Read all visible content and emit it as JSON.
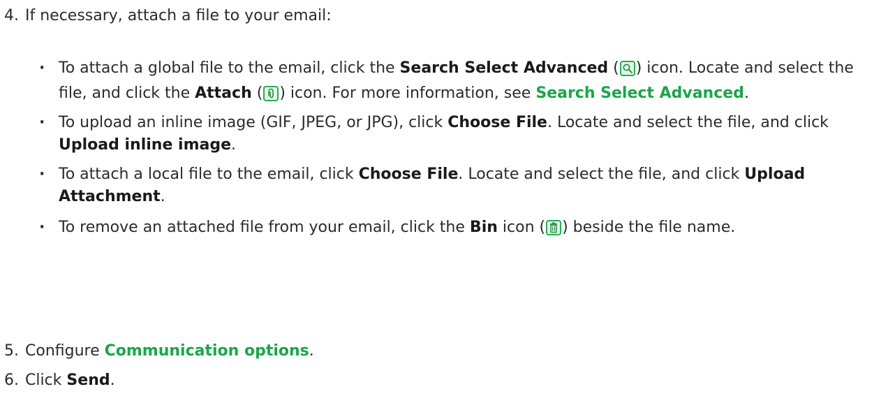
{
  "step4": {
    "number": "4.",
    "text": "If necessary, attach a file to your email:"
  },
  "bullets": [
    {
      "part1": "To attach a global file to the email, click the ",
      "bold1": "Search Select Advanced",
      "part2": " (",
      "icon1": "search-icon",
      "part3": ") icon. Locate and select the file, and click the ",
      "bold2": "Attach",
      "part4": " (",
      "icon2": "paperclip-icon",
      "part5": ") icon. For more information, see ",
      "link": "Search Select Advanced",
      "part6": "."
    },
    {
      "part1": "To upload an inline image (GIF, JPEG, or JPG), click ",
      "bold1": "Choose File",
      "part2": ". Locate and select the file, and click ",
      "bold2": "Upload inline image",
      "part3": "."
    },
    {
      "part1": "To attach a local file to the email, click ",
      "bold1": "Choose File",
      "part2": ". Locate and select the file, and click ",
      "bold2": "Upload Attachment",
      "part3": "."
    },
    {
      "part1": "To remove an attached file from your email, click the ",
      "bold1": "Bin",
      "part2": " icon (",
      "icon1": "bin-icon",
      "part3": ") beside the file name."
    }
  ],
  "step5": {
    "number": "5.",
    "prefix": "Configure ",
    "link": "Communication options",
    "suffix": "."
  },
  "step6": {
    "number": "6.",
    "prefix": "Click ",
    "bold": "Send",
    "suffix": "."
  },
  "colors": {
    "accent": "#1aa64a",
    "icon_border": "#22b04f"
  }
}
